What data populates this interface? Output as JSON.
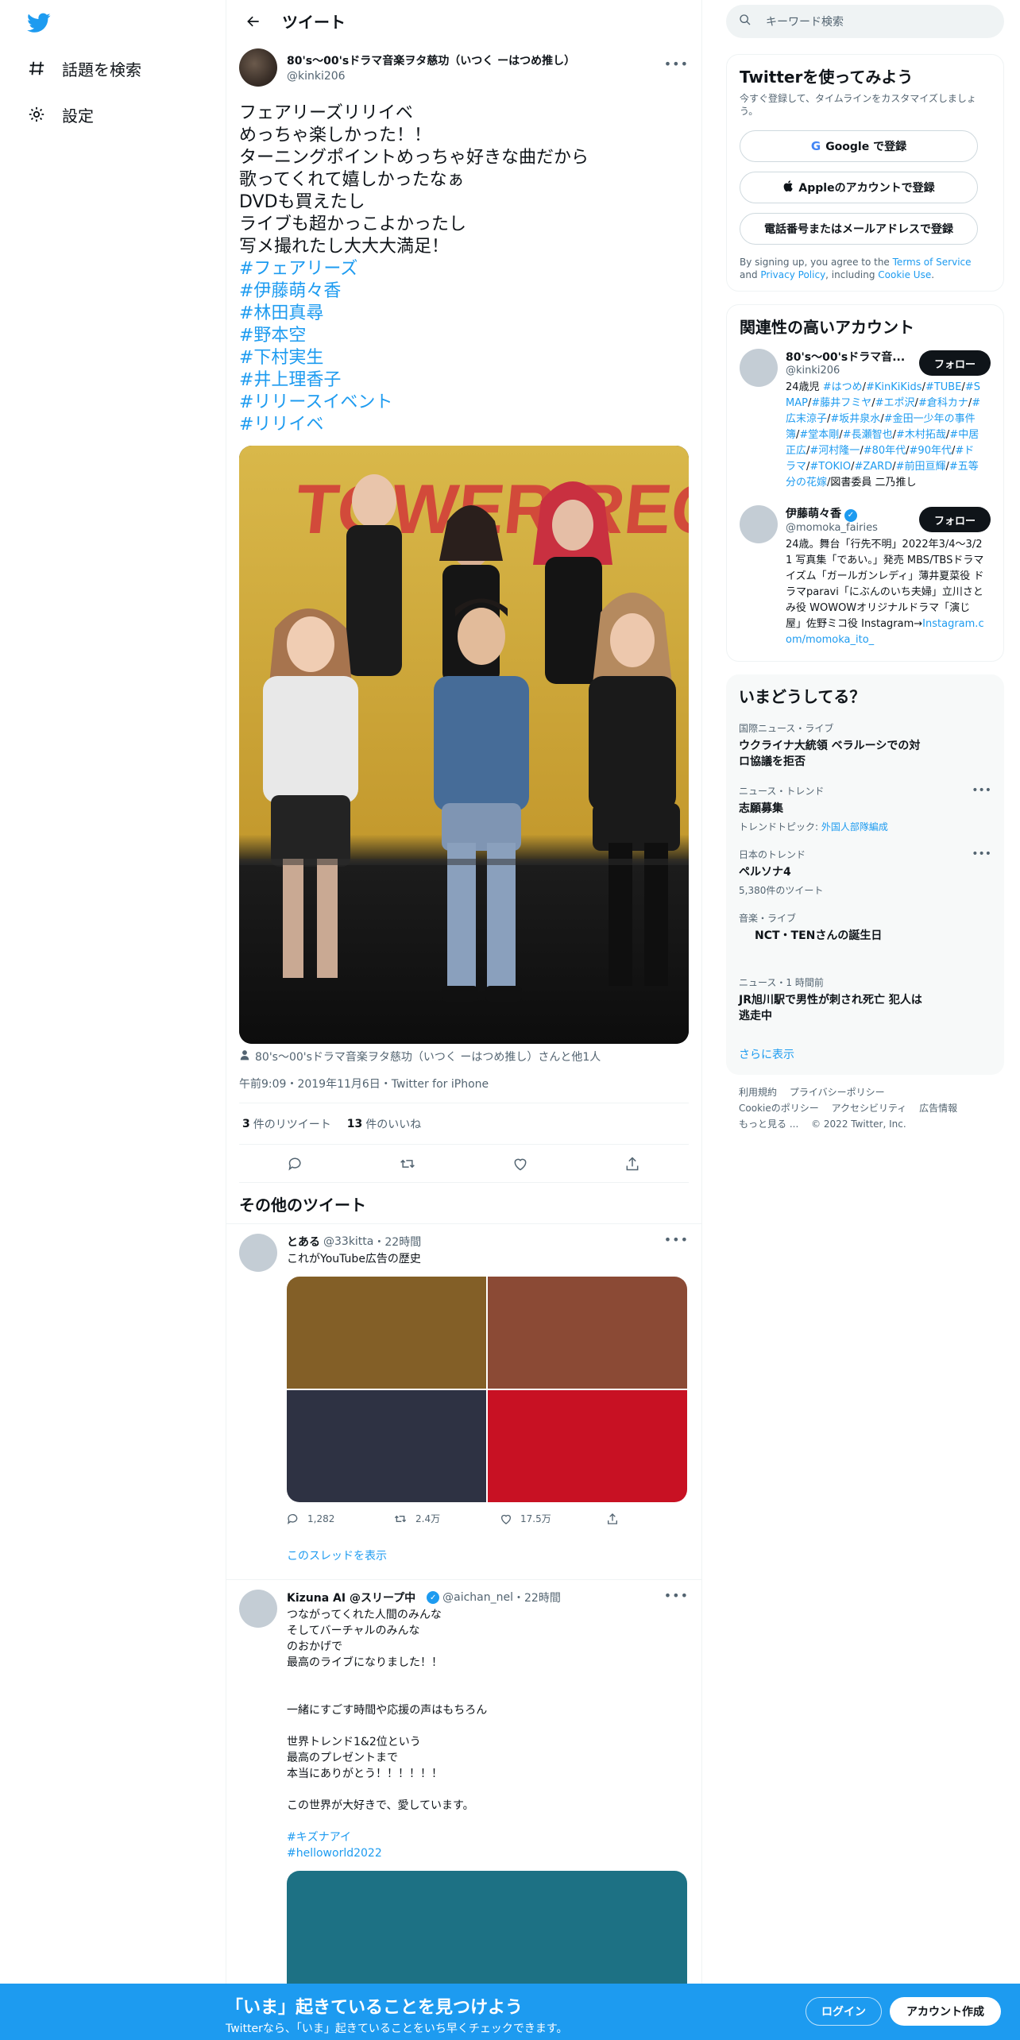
{
  "nav": {
    "explore_label": "話題を検索",
    "settings_label": "設定"
  },
  "header": {
    "title": "ツイート"
  },
  "tweet": {
    "display_name": "80's〜00'sドラマ音楽ヲタ慈功（いつく ーはつめ推し）",
    "username": "@kinki206",
    "lines": [
      "フェアリーズリリイベ",
      "めっちゃ楽しかった！！",
      "ターニングポイントめっちゃ好きな曲だから",
      "歌ってくれて嬉しかったなぁ",
      "DVDも買えたし",
      "ライブも超かっこよかったし",
      "写メ撮れたし大大大満足！"
    ],
    "hashtags": [
      "#フェアリーズ",
      "#伊藤萌々香",
      "#林田真尋",
      "#野本空",
      "#下村実生",
      "#井上理香子",
      "#リリースイベント",
      "#リリイベ"
    ],
    "banner_text": "TOWER RECORDS",
    "tagged": "80's〜00'sドラマ音楽ヲタ慈功（いつく ーはつめ推し）さんと他1人",
    "timestamp": "午前9:09・2019年11月6日・Twitter for iPhone",
    "retweet_count": "3",
    "retweet_label": "件のリツイート",
    "like_count": "13",
    "like_label": "件のいいね"
  },
  "more_tweets": {
    "title": "その他のツイート",
    "t1": {
      "display_name": "とある",
      "username": "@33kitta",
      "time": "・22時間",
      "text": "これがYouTube広告の歴史",
      "grid_colors": [
        "#835f27",
        "#8b4a35",
        "#2e3243",
        "#c81123"
      ],
      "replies": "1,282",
      "retweets": "2.4万",
      "likes": "17.5万",
      "show_thread": "このスレッドを表示"
    },
    "t2": {
      "display_name": "Kizuna AI @スリープ中",
      "username": "@aichan_nel",
      "time": "・22時間",
      "lines": [
        "つながってくれた人間のみんな",
        "そしてバーチャルのみんな",
        "のおかげで",
        "最高のライブになりました！！",
        "",
        "",
        "一緒にすごす時間や応援の声はもちろん",
        "",
        "世界トレンド1&2位という",
        "最高のプレゼントまで",
        "本当にありがとう！！！！！！",
        "",
        "この世界が大好きで、愛しています。",
        ""
      ],
      "hashtags": [
        "#キズナアイ",
        "#helloworld2022"
      ],
      "media_color": "#1d7184"
    }
  },
  "right": {
    "search_placeholder": "キーワード検索",
    "signup": {
      "title": "Twitterを使ってみよう",
      "subtitle": "今すぐ登録して、タイムラインをカスタマイズしましょう。",
      "google": "Google で登録",
      "google_letter": "G",
      "apple": "Appleのアカウントで登録",
      "phone": "電話番号またはメールアドレスで登録",
      "terms_pre": "By signing up, you agree to the ",
      "terms_link": "Terms of Service",
      "terms_mid": " and ",
      "privacy_link": "Privacy Policy",
      "terms_mid2": ", including ",
      "cookie_link": "Cookie Use",
      "terms_end": "."
    },
    "related": {
      "title": "関連性の高いアカウント",
      "follow": "フォロー",
      "a1": {
        "display_name": "80's〜00'sドラマ音...",
        "username": "@kinki206",
        "bio_parts": [
          [
            "24歳児 ",
            false
          ],
          [
            "#はつめ",
            true
          ],
          [
            "/",
            false
          ],
          [
            "#KinKiKids",
            true
          ],
          [
            "/",
            false
          ],
          [
            "#TUBE",
            true
          ],
          [
            "/",
            false
          ],
          [
            "#SMAP",
            true
          ],
          [
            "/",
            false
          ],
          [
            "#藤井フミヤ",
            true
          ],
          [
            "/",
            false
          ],
          [
            "#エポ沢",
            true
          ],
          [
            "/",
            false
          ],
          [
            "#倉科カナ",
            true
          ],
          [
            "/",
            false
          ],
          [
            "#広末涼子",
            true
          ],
          [
            "/",
            false
          ],
          [
            "#坂井泉水",
            true
          ],
          [
            "/",
            false
          ],
          [
            "#金田一少年の事件簿",
            true
          ],
          [
            "/",
            false
          ],
          [
            "#堂本剛",
            true
          ],
          [
            "/",
            false
          ],
          [
            "#長瀬智也",
            true
          ],
          [
            "/",
            false
          ],
          [
            "#木村拓哉",
            true
          ],
          [
            "/",
            false
          ],
          [
            "#中居正広",
            true
          ],
          [
            "/",
            false
          ],
          [
            "#河村隆一",
            true
          ],
          [
            "/",
            false
          ],
          [
            "#80年代",
            true
          ],
          [
            "/",
            false
          ],
          [
            "#90年代",
            true
          ],
          [
            "/",
            false
          ],
          [
            "#ドラマ",
            true
          ],
          [
            "/",
            false
          ],
          [
            "#TOKIO",
            true
          ],
          [
            "/",
            false
          ],
          [
            "#ZARD",
            true
          ],
          [
            "/",
            false
          ],
          [
            "#前田亘輝",
            true
          ],
          [
            "/",
            false
          ],
          [
            "#五等分の花嫁",
            true
          ],
          [
            "/図書委員 二乃推し",
            false
          ]
        ]
      },
      "a2": {
        "display_name": "伊藤萌々香",
        "username": "@momoka_fairies",
        "bio": "24歳。舞台「行先不明」2022年3/4〜3/21 写真集「であい。」発売 MBS/TBSドラマイズム「ガールガンレディ」薄井夏菜役 ドラマparavi「にぶんのいち夫婦」立川さとみ役 WOWOWオリジナルドラマ「演じ屋」佐野ミコ役 Instagram→",
        "bio_link": "Instagram.com/momoka_ito_"
      }
    },
    "trends": {
      "title": "いまどうしてる？",
      "items": [
        {
          "ctx": "国際ニュース・ライブ",
          "name": "ウクライナ大統領 ベラルーシでの対ロ協議を拒否",
          "extra": "",
          "extra_link": ""
        },
        {
          "ctx": "ニュース・トレンド",
          "name": "志願募集",
          "extra": "トレンドトピック: ",
          "extra_link": "外国人部隊編成"
        },
        {
          "ctx": "日本のトレンド",
          "name": "ペルソナ4",
          "extra": "5,380件のツイート",
          "extra_link": ""
        },
        {
          "ctx": "音楽・ライブ",
          "name": "NCT・TENさんの誕生日",
          "extra": "",
          "extra_link": ""
        },
        {
          "ctx": "ニュース・1 時間前",
          "name": "JR旭川駅で男性が刺され死亡 犯人は逃走中",
          "extra": "",
          "extra_link": ""
        }
      ],
      "show_more": "さらに表示"
    },
    "footer": {
      "line1": [
        "利用規約",
        "プライバシーポリシー"
      ],
      "line2": [
        "Cookieのポリシー",
        "アクセシビリティ",
        "広告情報"
      ],
      "line3": [
        "もっと見る ...",
        "© 2022 Twitter, Inc."
      ]
    }
  },
  "bottom": {
    "title": "「いま」起きていることを見つけよう",
    "subtitle": "Twitterなら、「いま」起きていることをいち早くチェックできます。",
    "login": "ログイン",
    "signup": "アカウント作成"
  },
  "colors": {
    "brand": "#1d9bf0",
    "text": "#0f1419",
    "secondary": "#536471"
  }
}
